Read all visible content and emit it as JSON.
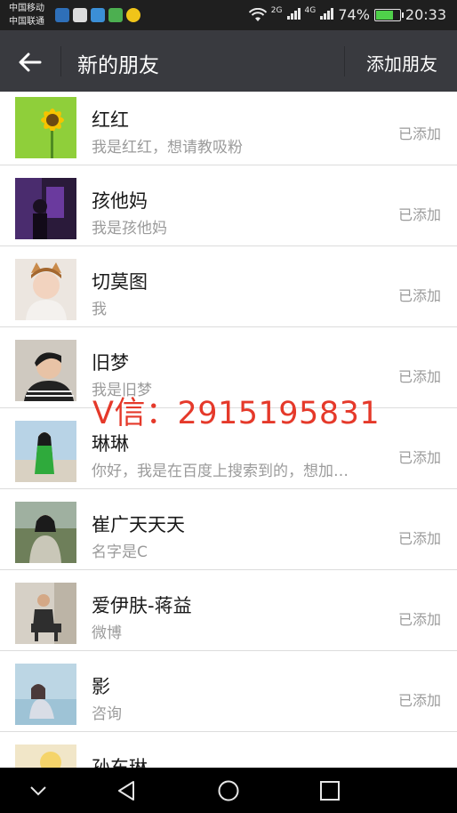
{
  "statusbar": {
    "carrier_1": "中国移动",
    "carrier_2": "中国联通",
    "net_1": "2G",
    "net_2": "4G",
    "battery": "74%",
    "time": "20:33",
    "battery_level": 0.74,
    "colors": {
      "battery_fill": "#4fd14a",
      "background": "#1f1f1f"
    }
  },
  "header": {
    "title": "新的朋友",
    "action": "添加朋友",
    "back_icon": "arrow-left-icon",
    "background": "#393a3f"
  },
  "friends": [
    {
      "name": "红红",
      "message": "我是红红，想请教吸粉",
      "status": "已添加",
      "avatar": "sunflower-avatar"
    },
    {
      "name": "孩他妈",
      "message": "我是孩他妈",
      "status": "已添加",
      "avatar": "dark-room-avatar"
    },
    {
      "name": "切莫图",
      "message": "我",
      "status": "已添加",
      "avatar": "child-cat-ears-avatar"
    },
    {
      "name": "旧梦",
      "message": "我是旧梦",
      "status": "已添加",
      "avatar": "young-man-avatar"
    },
    {
      "name": "琳琳",
      "message": "你好，我是在百度上搜索到的，想加…",
      "status": "已添加",
      "avatar": "woman-green-dress-avatar"
    },
    {
      "name": "崔广天天天",
      "message": "名字是C",
      "status": "已添加",
      "avatar": "woman-outdoor-avatar"
    },
    {
      "name": "爱伊肤-蒋益",
      "message": "微博",
      "status": "已添加",
      "avatar": "man-sitting-avatar"
    },
    {
      "name": "影",
      "message": "咨询",
      "status": "已添加",
      "avatar": "girl-seaside-avatar"
    },
    {
      "name": "孙东琳",
      "message": "",
      "status": "",
      "avatar": "partial-avatar"
    }
  ],
  "overlay_text": "V信：2915195831",
  "navbar": {
    "back": "nav-back-icon",
    "home": "nav-home-icon",
    "recents": "nav-recents-icon",
    "collapse": "chevron-down-icon"
  }
}
